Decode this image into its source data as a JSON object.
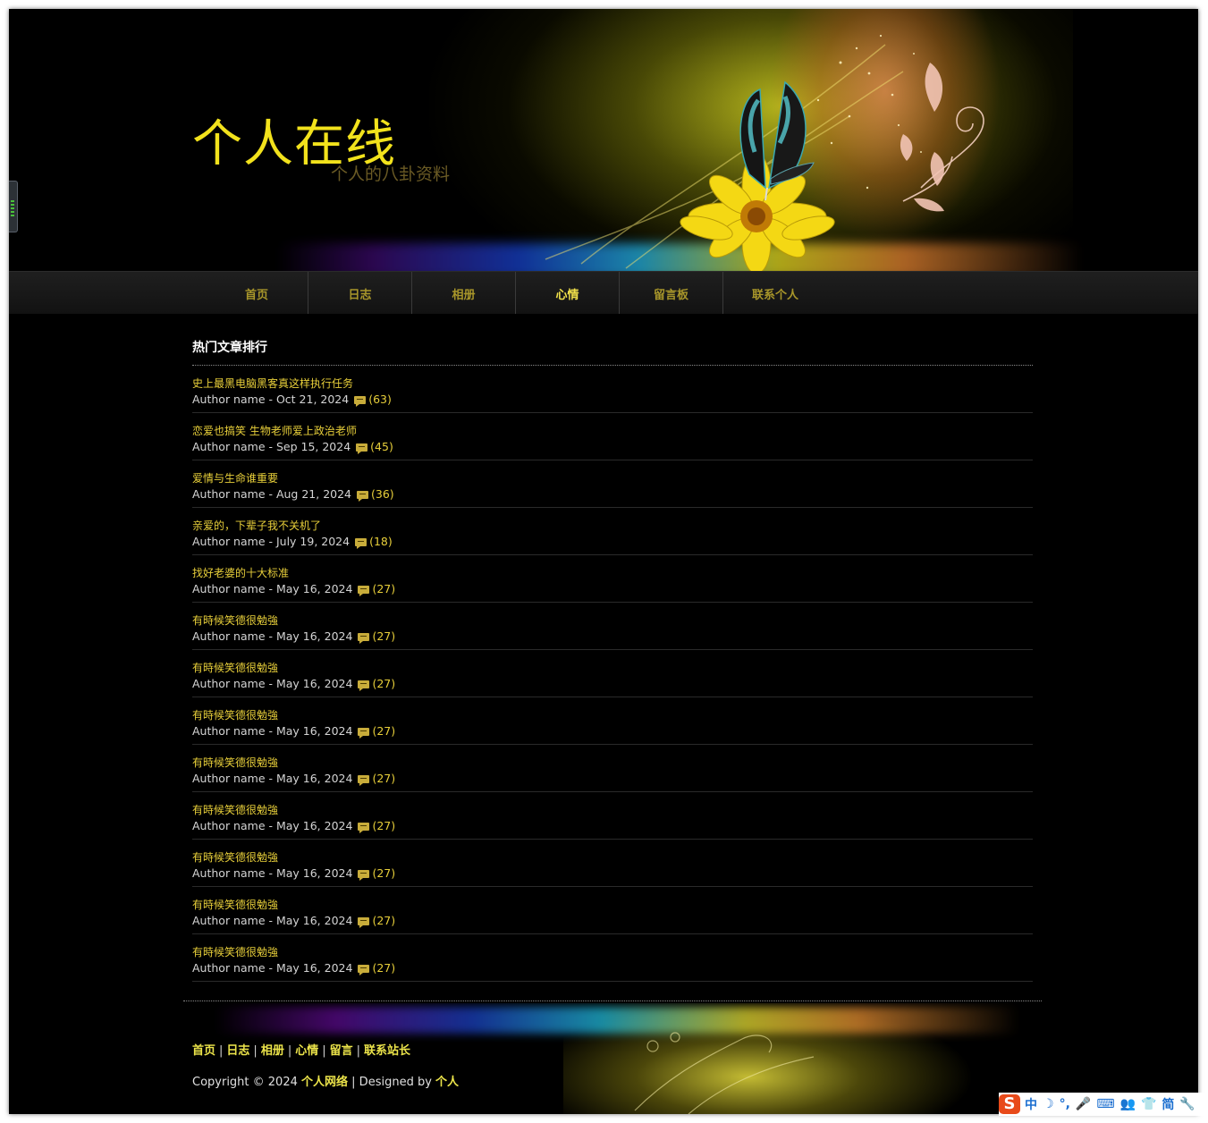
{
  "site": {
    "title": "个人在线",
    "subtitle": "个人的八卦资料"
  },
  "nav": {
    "items": [
      {
        "label": "首页",
        "active": false
      },
      {
        "label": "日志",
        "active": false
      },
      {
        "label": "相册",
        "active": false
      },
      {
        "label": "心情",
        "active": true
      },
      {
        "label": "留言板",
        "active": false
      },
      {
        "label": "联系个人",
        "active": false
      }
    ]
  },
  "content": {
    "heading": "热门文章排行",
    "articles": [
      {
        "title": "史上最黑电脑黑客真这样执行任务",
        "meta": "Author name - Oct 21, 2024",
        "count": "(63)"
      },
      {
        "title": "恋爱也搞笑 生物老师爱上政治老师",
        "meta": "Author name - Sep 15, 2024",
        "count": "(45)"
      },
      {
        "title": "爱情与生命谁重要",
        "meta": "Author name - Aug 21, 2024",
        "count": "(36)"
      },
      {
        "title": "亲爱的，下辈子我不关机了",
        "meta": "Author name - July 19, 2024",
        "count": "(18)"
      },
      {
        "title": "找好老婆的十大标准",
        "meta": "Author name - May 16, 2024",
        "count": "(27)"
      },
      {
        "title": "有時候笑德很勉強",
        "meta": "Author name - May 16, 2024",
        "count": "(27)"
      },
      {
        "title": "有時候笑德很勉強",
        "meta": "Author name - May 16, 2024",
        "count": "(27)"
      },
      {
        "title": "有時候笑德很勉強",
        "meta": "Author name - May 16, 2024",
        "count": "(27)"
      },
      {
        "title": "有時候笑德很勉強",
        "meta": "Author name - May 16, 2024",
        "count": "(27)"
      },
      {
        "title": "有時候笑德很勉強",
        "meta": "Author name - May 16, 2024",
        "count": "(27)"
      },
      {
        "title": "有時候笑德很勉強",
        "meta": "Author name - May 16, 2024",
        "count": "(27)"
      },
      {
        "title": "有時候笑德很勉強",
        "meta": "Author name - May 16, 2024",
        "count": "(27)"
      },
      {
        "title": "有時候笑德很勉強",
        "meta": "Author name - May 16, 2024",
        "count": "(27)"
      }
    ]
  },
  "footer": {
    "links": [
      "首页",
      "日志",
      "相册",
      "心情",
      "留言",
      "联系站长"
    ],
    "separator": "|",
    "copyright_prefix": "Copyright © 2024",
    "copyright_brand": "个人网络",
    "designed_by_label": "| Designed by",
    "designer": "个人"
  },
  "ime": {
    "logo": "S",
    "items": [
      "中",
      "☽",
      "°,",
      "🎤",
      "⌨",
      "👥",
      "👕",
      "简",
      "🔧"
    ]
  },
  "colors": {
    "accent": "#f2e21c",
    "link": "#e8cf3a",
    "nav_text": "#a8962a",
    "background": "#000000"
  }
}
